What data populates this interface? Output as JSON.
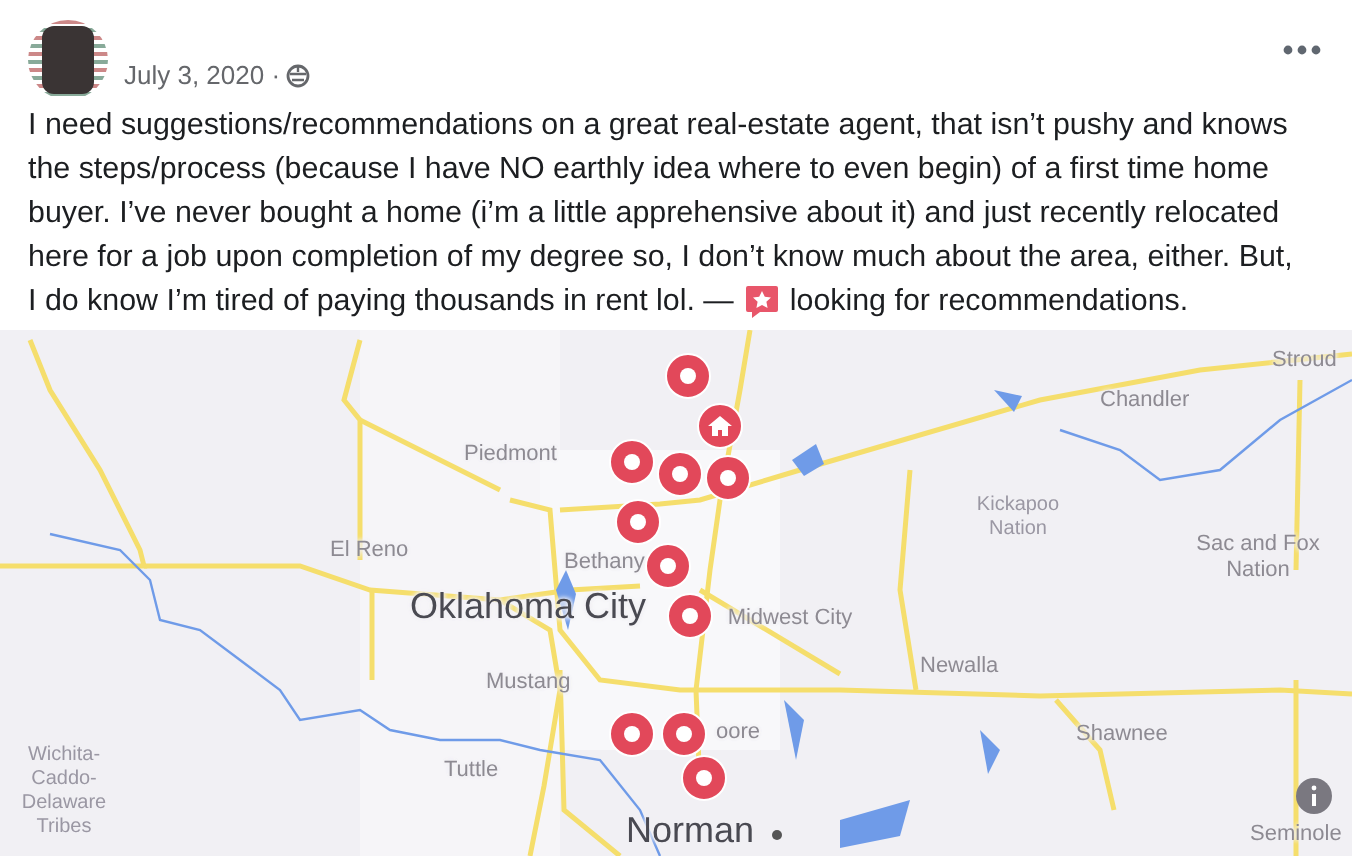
{
  "post": {
    "date": "July 3, 2020 ·",
    "body_before_icon": "I need suggestions/recommendations on a great real-estate agent, that isn’t pushy and knows the steps/process (because I have NO earthly idea where to even begin) of a first time home buyer. I’ve never bought a home (i’m a little apprehensive about it) and just recently relocated here for a job upon completion of my degree so, I don’t know much about the area, either. But,",
    "body_last_line": "I do know I’m tired of paying thousands in rent lol. —",
    "body_after_icon": "looking for recommendations."
  },
  "map": {
    "labels": [
      {
        "text": "Stroud",
        "kind": "town"
      },
      {
        "text": "Chandler",
        "kind": "town"
      },
      {
        "text": "Piedmont",
        "kind": "town"
      },
      {
        "text": "Kickapoo Nation",
        "kind": "region"
      },
      {
        "text": "El Reno",
        "kind": "town"
      },
      {
        "text": "Bethany",
        "kind": "town"
      },
      {
        "text": "Sac and Fox Nation",
        "kind": "twoline"
      },
      {
        "text": "Oklahoma City",
        "kind": "major"
      },
      {
        "text": "Midwest City",
        "kind": "twoline"
      },
      {
        "text": "Newalla",
        "kind": "town"
      },
      {
        "text": "Mustang",
        "kind": "town"
      },
      {
        "text": "Wichita-Caddo-Delaware Tribes",
        "kind": "region"
      },
      {
        "text": "oore",
        "kind": "town"
      },
      {
        "text": "Shawnee",
        "kind": "town"
      },
      {
        "text": "Tuttle",
        "kind": "town"
      },
      {
        "text": "Norman",
        "kind": "major"
      },
      {
        "text": "Seminole",
        "kind": "town"
      }
    ]
  }
}
